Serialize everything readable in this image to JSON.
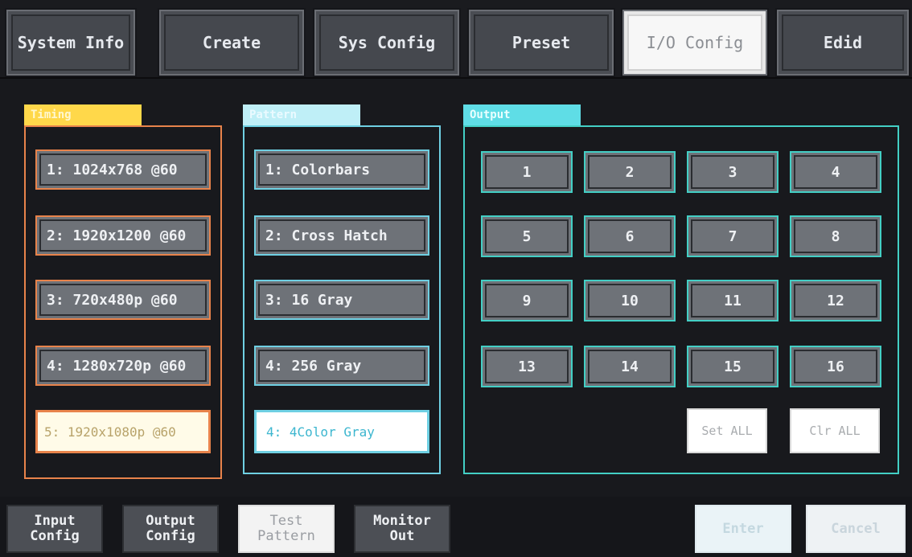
{
  "top_tabs": [
    {
      "label": "System Info"
    },
    {
      "label": "Create"
    },
    {
      "label": "Sys Config"
    },
    {
      "label": "Preset"
    },
    {
      "label": "I/O Config"
    },
    {
      "label": "Edid"
    }
  ],
  "timing": {
    "title": "Timing",
    "items": [
      {
        "label": "1: 1024x768 @60"
      },
      {
        "label": "2: 1920x1200 @60"
      },
      {
        "label": "3: 720x480p @60"
      },
      {
        "label": "4: 1280x720p @60"
      },
      {
        "label": "5: 1920x1080p @60"
      }
    ]
  },
  "pattern": {
    "title": "Pattern",
    "items": [
      {
        "label": "1: Colorbars"
      },
      {
        "label": "2: Cross Hatch"
      },
      {
        "label": "3: 16 Gray"
      },
      {
        "label": "4: 256 Gray"
      },
      {
        "label": "4: 4Color Gray"
      }
    ]
  },
  "output": {
    "title": "Output",
    "items": [
      "1",
      "2",
      "3",
      "4",
      "5",
      "6",
      "7",
      "8",
      "9",
      "10",
      "11",
      "12",
      "13",
      "14",
      "15",
      "16"
    ],
    "set_all": "Set ALL",
    "clr_all": "Clr ALL"
  },
  "bottom": {
    "input_config": "Input\nConfig",
    "output_config": "Output\nConfig",
    "test_pattern": "Test\nPattern",
    "monitor_out": "Monitor\nOut",
    "enter": "Enter",
    "cancel": "Cancel"
  },
  "colors": {
    "timing_accent": "#ffd84a",
    "pattern_accent": "#bfeff7",
    "output_accent": "#5fdde6"
  }
}
